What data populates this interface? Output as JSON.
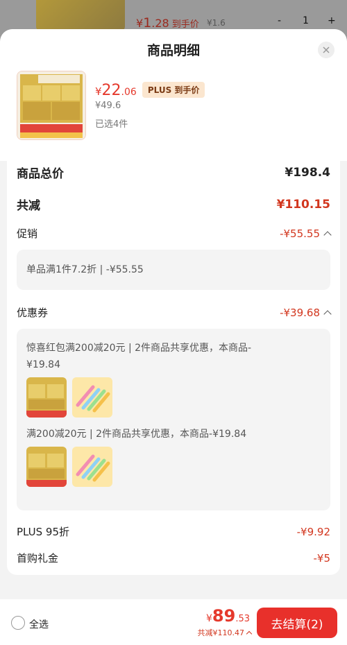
{
  "background": {
    "price_symbol": "¥",
    "price_int": "1",
    "price_dec": ".28",
    "price_tag": "到手价",
    "orig_price": "¥1.6",
    "qty_minus": "-",
    "qty": "1",
    "qty_plus": "+"
  },
  "sheet": {
    "title": "商品明细",
    "close_icon": "close-icon"
  },
  "product": {
    "price_symbol": "¥",
    "price_int": "22",
    "price_dec": ".06",
    "plus_badge": "PLUS 到手价",
    "orig_price": "¥49.6",
    "selected": "已选4件"
  },
  "details": {
    "total_label": "商品总价",
    "total_value": "¥198.4",
    "reduce_label": "共减",
    "reduce_value": "¥110.15",
    "promo_label": "促销",
    "promo_value": "-¥55.55",
    "promo_detail": "单品满1件7.2折 | -¥55.55",
    "coupon_label": "优惠券",
    "coupon_value": "-¥39.68",
    "coupon1_detail": "惊喜红包满200减20元 | 2件商品共享优惠，本商品-¥19.84",
    "coupon2_detail": "满200减20元 | 2件商品共享优惠，本商品-¥19.84",
    "plus_label": "PLUS 95折",
    "plus_value": "-¥9.92",
    "first_label": "首购礼金",
    "first_value": "-¥5"
  },
  "footer": {
    "select_all": "全选",
    "total_symbol": "¥",
    "total_int": "89",
    "total_dec": ".53",
    "savings": "共减¥110.47",
    "checkout": "去结算(2)"
  },
  "colors": {
    "accent": "#e5392c",
    "checkout_bg": "#e8302b",
    "plus_badge_bg": "#fbe6cf"
  }
}
